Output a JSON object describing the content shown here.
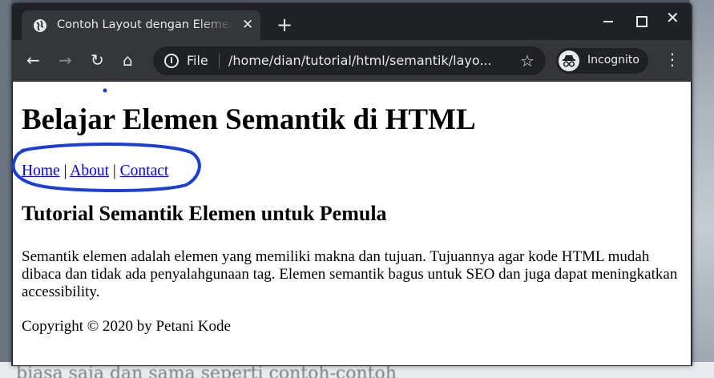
{
  "browser": {
    "tab_title": "Contoh Layout dengan Elemen Semantik",
    "tab_close": "✕",
    "new_tab": "+",
    "window_close": "✕",
    "back": "←",
    "forward": "→",
    "reload": "↻",
    "home": "⌂",
    "info_icon": "i",
    "scheme": "File",
    "url": "/home/dian/tutorial/html/semantik/layo...",
    "bookmark": "☆",
    "incognito_label": "Incognito",
    "menu": "⋮"
  },
  "page": {
    "title": "Belajar Elemen Semantik di HTML",
    "nav": [
      {
        "label": "Home"
      },
      {
        "label": "About"
      },
      {
        "label": "Contact"
      }
    ],
    "nav_separator": " | ",
    "section_title": "Tutorial Semantik Elemen untuk Pemula",
    "paragraph": "Semantik elemen adalah elemen yang memiliki makna dan tujuan. Tujuannya agar kode HTML mudah dibaca dan tidak ada penyalahgunaan tag. Elemen semantik bagus untuk SEO dan juga dapat meningkatkan accessibility.",
    "footer": "Copyright © 2020 by Petani Kode"
  },
  "background_text": "biasa saja dan sama seperti contoh-contoh",
  "colors": {
    "chrome_dark": "#202124",
    "chrome_toolbar": "#35363a",
    "link": "#0000ee",
    "annotation": "#1a3fd6"
  }
}
